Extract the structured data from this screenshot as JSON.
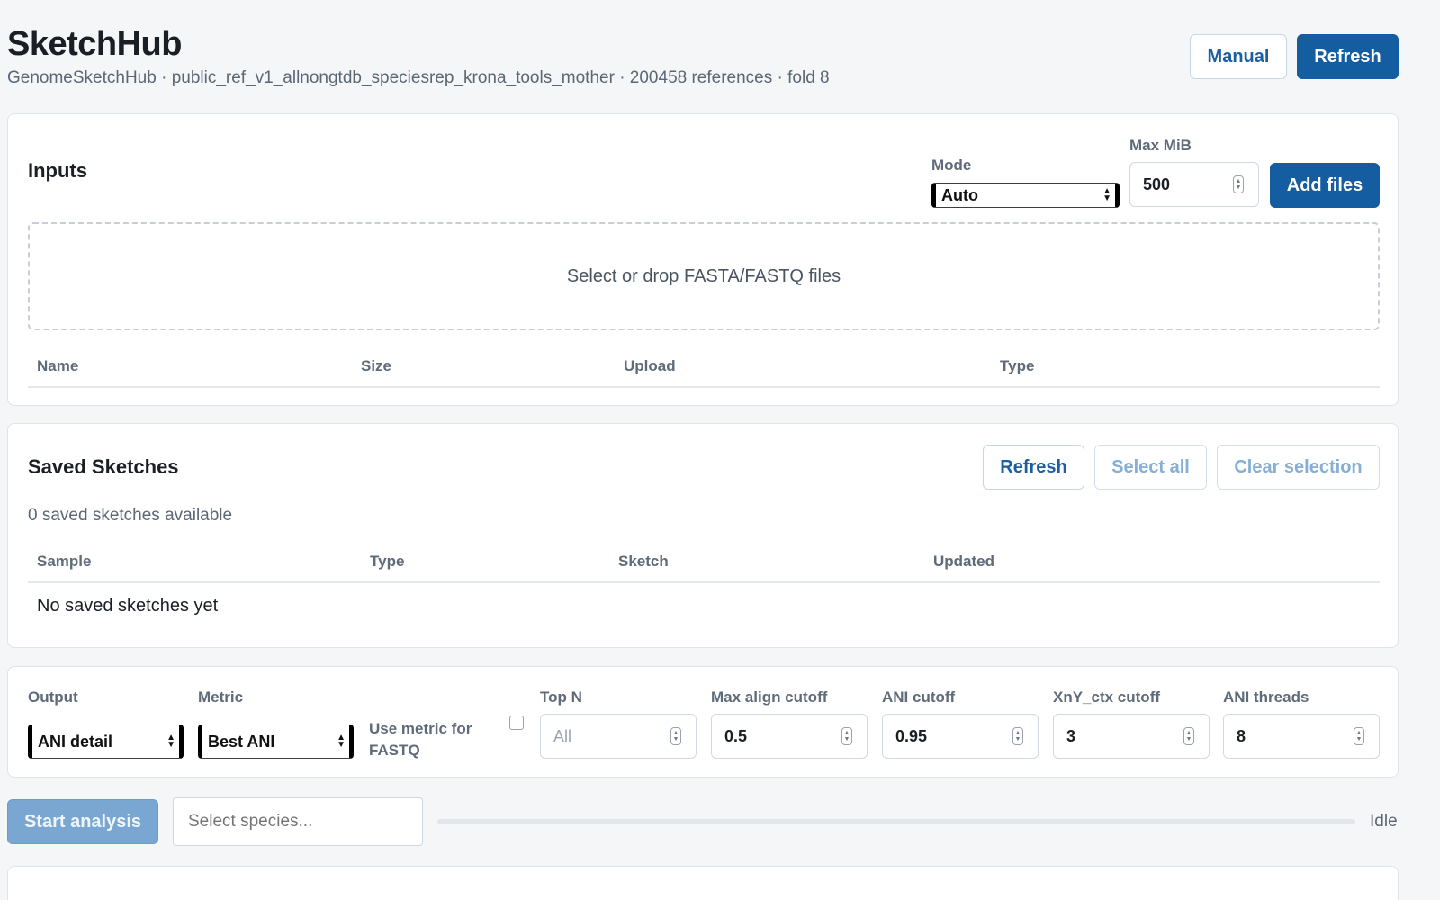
{
  "header": {
    "title": "SketchHub",
    "subtitle": "GenomeSketchHub · public_ref_v1_allnongtdb_speciesrep_krona_tools_mother · 200458 references · fold 8",
    "manual_label": "Manual",
    "refresh_label": "Refresh"
  },
  "inputs": {
    "title": "Inputs",
    "mode_label": "Mode",
    "mode_value": "Auto",
    "max_mib_label": "Max MiB",
    "max_mib_value": "500",
    "add_files_label": "Add files",
    "dropzone_text": "Select or drop FASTA/FASTQ files",
    "columns": [
      "Name",
      "Size",
      "Upload",
      "Type"
    ]
  },
  "saved": {
    "title": "Saved Sketches",
    "refresh_label": "Refresh",
    "select_all_label": "Select all",
    "clear_selection_label": "Clear selection",
    "count_text": "0 saved sketches available",
    "columns": [
      "Sample",
      "Type",
      "Sketch",
      "Updated"
    ],
    "empty_text": "No saved sketches yet"
  },
  "options": {
    "output_label": "Output",
    "output_value": "ANI detail",
    "metric_label": "Metric",
    "metric_value": "Best ANI",
    "use_metric_label": "Use metric for FASTQ",
    "use_metric_checked": false,
    "top_n_label": "Top N",
    "top_n_placeholder": "All",
    "max_align_label": "Max align cutoff",
    "max_align_value": "0.5",
    "ani_cutoff_label": "ANI cutoff",
    "ani_cutoff_value": "0.95",
    "xny_label": "XnY_ctx cutoff",
    "xny_value": "3",
    "ani_threads_label": "ANI threads",
    "ani_threads_value": "8"
  },
  "run": {
    "start_label": "Start analysis",
    "species_placeholder": "Select species...",
    "status": "Idle",
    "progress": 0
  }
}
